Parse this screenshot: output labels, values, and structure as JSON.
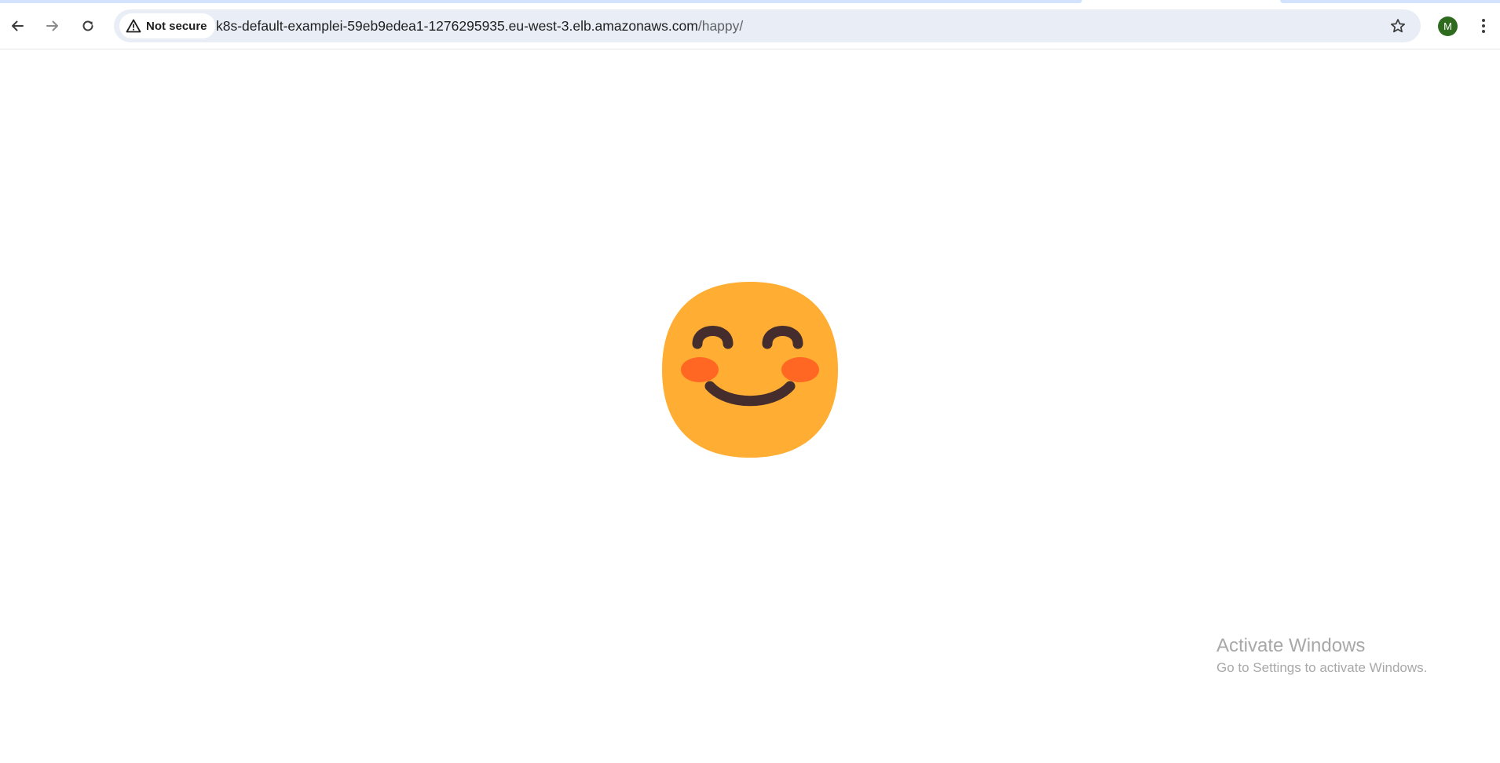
{
  "browser": {
    "security_label": "Not secure",
    "url_host": "k8s-default-examplei-59eb9edea1-1276295935.eu-west-3.elb.amazonaws.com",
    "url_path": "/happy/",
    "profile_initial": "M",
    "profile_color": "#2e6b1f",
    "icons": {
      "back": "arrow-left-icon",
      "forward": "arrow-right-icon",
      "reload": "reload-icon",
      "security": "warning-triangle-icon",
      "bookmark": "star-outline-icon",
      "menu": "kebab-menu-icon"
    }
  },
  "page": {
    "content": "smiling-face-with-blushing-cheeks-emoji",
    "colors": {
      "face": "#ffad33",
      "features": "#452d2d",
      "cheeks": "#ff6723"
    }
  },
  "watermark": {
    "title": "Activate Windows",
    "subtitle": "Go to Settings to activate Windows."
  }
}
